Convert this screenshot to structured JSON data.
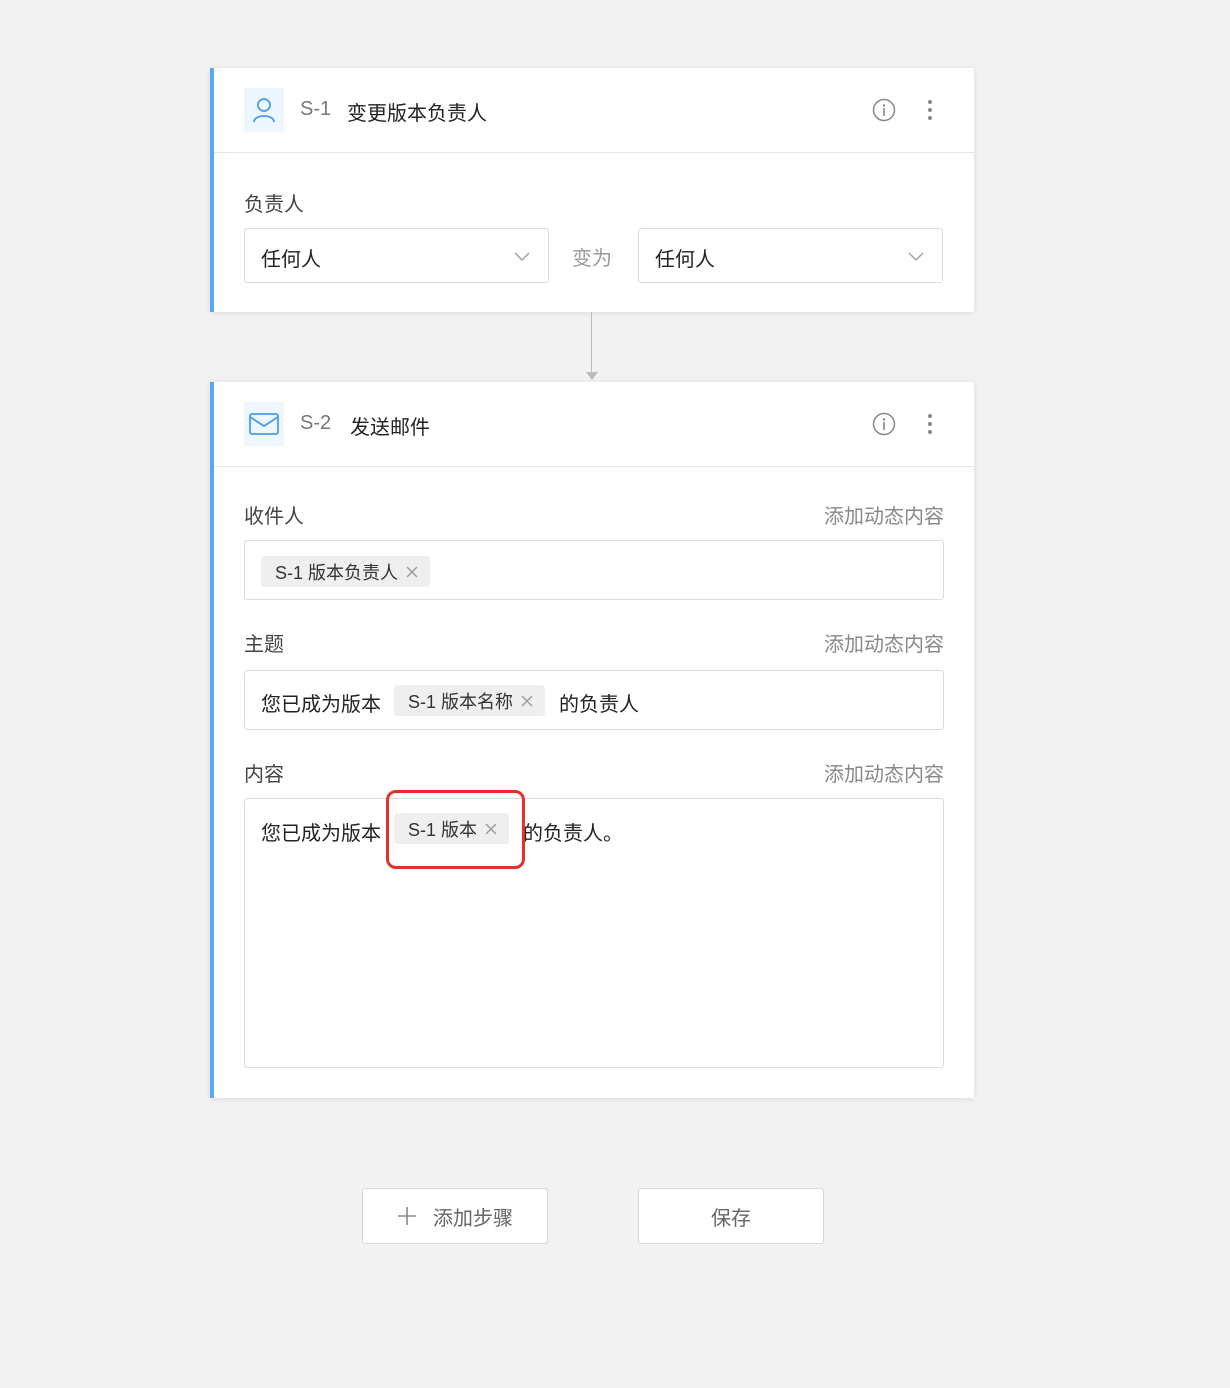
{
  "step1": {
    "id": "S-1",
    "title": "变更版本负责人",
    "field_label": "负责人",
    "from_value": "任何人",
    "change_to": "变为",
    "to_value": "任何人"
  },
  "step2": {
    "id": "S-2",
    "title": "发送邮件",
    "recipients": {
      "label": "收件人",
      "add_dynamic": "添加动态内容",
      "tag": "S-1 版本负责人"
    },
    "subject": {
      "label": "主题",
      "add_dynamic": "添加动态内容",
      "prefix": "您已成为版本",
      "tag": "S-1 版本名称",
      "suffix": "的负责人"
    },
    "body": {
      "label": "内容",
      "add_dynamic": "添加动态内容",
      "prefix": "您已成为版本",
      "tag": "S-1 版本",
      "suffix": "的负责人。"
    }
  },
  "footer": {
    "add_step": "添加步骤",
    "save": "保存"
  },
  "icons": {
    "step1": "user-icon",
    "step2": "mail-icon",
    "info": "info-icon",
    "more": "more-vertical-icon",
    "dropdown": "chevron-down-icon",
    "remove": "close-icon",
    "add": "plus-icon"
  },
  "colors": {
    "accent": "#5aa8f2",
    "highlight": "#e8302a"
  }
}
